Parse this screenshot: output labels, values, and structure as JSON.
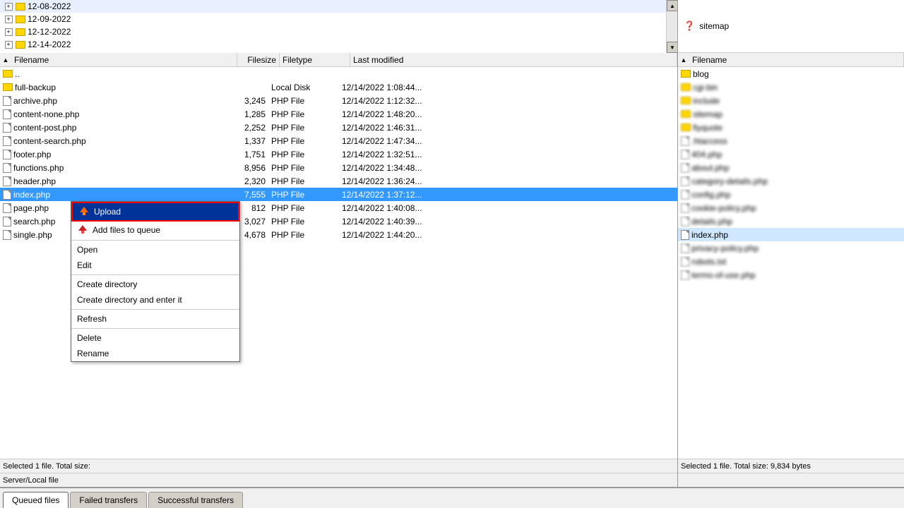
{
  "tree": {
    "items": [
      {
        "label": "12-08-2022",
        "expanded": true,
        "indent": 2
      },
      {
        "label": "12-09-2022",
        "expanded": true,
        "indent": 2
      },
      {
        "label": "12-12-2022",
        "expanded": true,
        "indent": 2
      },
      {
        "label": "12-14-2022",
        "expanded": true,
        "indent": 2
      }
    ]
  },
  "left_header": {
    "filename_col": "Filename",
    "filesize_col": "Filesize",
    "filetype_col": "Filetype",
    "lastmod_col": "Last modified"
  },
  "files": [
    {
      "name": "..",
      "type": "folder",
      "size": "",
      "filetype": "",
      "lastmod": ""
    },
    {
      "name": "full-backup",
      "type": "folder",
      "size": "",
      "filetype": "Local Disk",
      "lastmod": "12/14/2022 1:08:44..."
    },
    {
      "name": "archive.php",
      "type": "file",
      "size": "3,245",
      "filetype": "PHP File",
      "lastmod": "12/14/2022 1:12:32..."
    },
    {
      "name": "content-none.php",
      "type": "file",
      "size": "1,285",
      "filetype": "PHP File",
      "lastmod": "12/14/2022 1:48:20..."
    },
    {
      "name": "content-post.php",
      "type": "file",
      "size": "2,252",
      "filetype": "PHP File",
      "lastmod": "12/14/2022 1:46:31..."
    },
    {
      "name": "content-search.php",
      "type": "file",
      "size": "1,337",
      "filetype": "PHP File",
      "lastmod": "12/14/2022 1:47:34..."
    },
    {
      "name": "footer.php",
      "type": "file",
      "size": "1,751",
      "filetype": "PHP File",
      "lastmod": "12/14/2022 1:32:51..."
    },
    {
      "name": "functions.php",
      "type": "file",
      "size": "8,956",
      "filetype": "PHP File",
      "lastmod": "12/14/2022 1:34:48..."
    },
    {
      "name": "header.php",
      "type": "file",
      "size": "2,320",
      "filetype": "PHP File",
      "lastmod": "12/14/2022 1:36:24..."
    },
    {
      "name": "index.php",
      "type": "file",
      "size": "7,555",
      "filetype": "PHP File",
      "lastmod": "12/14/2022 1:37:12...",
      "selected": true
    },
    {
      "name": "page.php",
      "type": "file",
      "size": "812",
      "filetype": "PHP File",
      "lastmod": "12/14/2022 1:40:08..."
    },
    {
      "name": "search.php",
      "type": "file",
      "size": "3,027",
      "filetype": "PHP File",
      "lastmod": "12/14/2022 1:40:39..."
    },
    {
      "name": "single.php",
      "type": "file",
      "size": "4,678",
      "filetype": "PHP File",
      "lastmod": "12/14/2022 1:44:20..."
    }
  ],
  "context_menu": {
    "items": [
      {
        "label": "Upload",
        "type": "upload",
        "icon": "upload"
      },
      {
        "label": "Add files to queue",
        "type": "item",
        "icon": "add-queue"
      },
      {
        "separator": true
      },
      {
        "label": "Open",
        "type": "item"
      },
      {
        "label": "Edit",
        "type": "item"
      },
      {
        "separator": true
      },
      {
        "label": "Create directory",
        "type": "item"
      },
      {
        "label": "Create directory and enter it",
        "type": "item"
      },
      {
        "separator": true
      },
      {
        "label": "Refresh",
        "type": "item"
      },
      {
        "separator": true
      },
      {
        "label": "Delete",
        "type": "item"
      },
      {
        "label": "Rename",
        "type": "item"
      }
    ]
  },
  "right_header": {
    "filename_col": "Filename"
  },
  "right_files": [
    {
      "name": "blog",
      "type": "folder"
    },
    {
      "name": "cgi-bin",
      "type": "folder",
      "blurred": true
    },
    {
      "name": "include",
      "type": "folder",
      "blurred": true
    },
    {
      "name": "sitemap",
      "type": "folder",
      "blurred": true
    },
    {
      "name": "fiyquote",
      "type": "folder",
      "blurred": true
    },
    {
      "name": ".htaccess",
      "type": "file",
      "blurred": true
    },
    {
      "name": "404.php",
      "type": "file",
      "blurred": true
    },
    {
      "name": "about.php",
      "type": "file",
      "blurred": true
    },
    {
      "name": "category-details.php",
      "type": "file",
      "blurred": true
    },
    {
      "name": "config.php",
      "type": "file",
      "blurred": true
    },
    {
      "name": "cookie-policy.php",
      "type": "file",
      "blurred": true
    },
    {
      "name": "details.php",
      "type": "file",
      "blurred": true
    },
    {
      "name": "index.php",
      "type": "file",
      "selected": true
    },
    {
      "name": "privacy-policy.php",
      "type": "file",
      "blurred": true
    },
    {
      "name": "robots.txt",
      "type": "file",
      "blurred": true
    },
    {
      "name": "terms-of-use.php",
      "type": "file",
      "blurred": true
    }
  ],
  "right_tree": {
    "item": "sitemap",
    "has_question": true
  },
  "status": {
    "left": "Selected 1 file. Total size:",
    "right": "Selected 1 file. Total size: 9,834 bytes"
  },
  "server_local": {
    "left": "Server/Local file",
    "right": ""
  },
  "selected_bar": {
    "left": "Selected",
    "right": "Selected"
  },
  "tabs": {
    "queued": "Queued files",
    "failed": "Failed transfers",
    "successful": "Successful transfers"
  }
}
